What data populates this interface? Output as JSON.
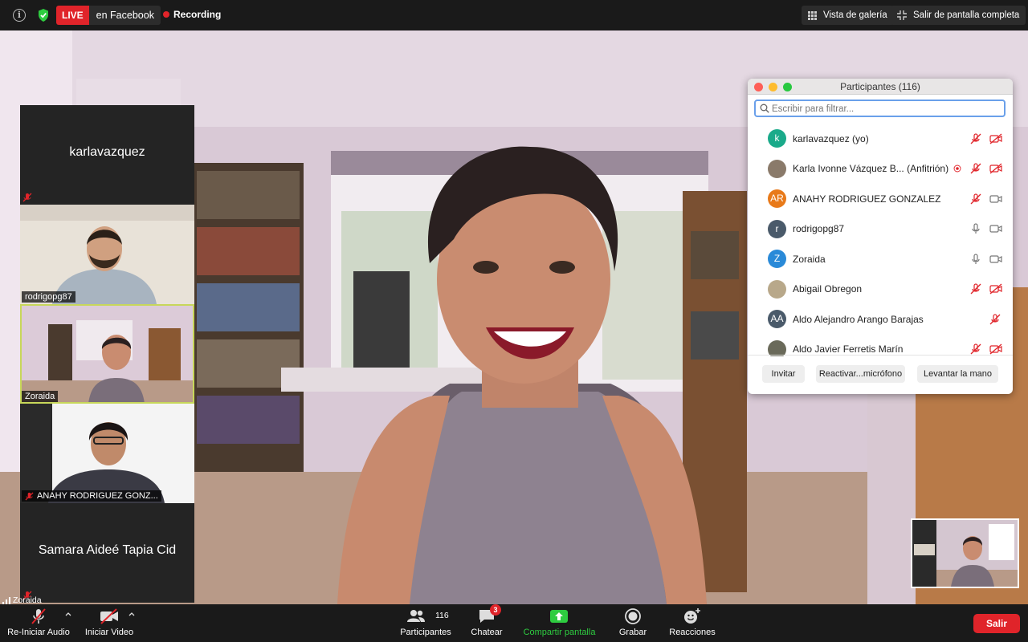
{
  "top_bar": {
    "live_badge": "LIVE",
    "live_destination": "en Facebook",
    "recording": "Recording",
    "gallery_view": "Vista de galería",
    "exit_fullscreen": "Salir de pantalla completa"
  },
  "thumbnails": [
    {
      "name": "karlavazquez",
      "video": false,
      "muted": true
    },
    {
      "name": "rodrigopg87",
      "video": true,
      "muted": false
    },
    {
      "name": "Zoraida",
      "video": true,
      "muted": false,
      "active": true
    },
    {
      "name": "ANAHY RODRIGUEZ GONZ...",
      "video": true,
      "muted": true
    },
    {
      "name": "Samara Aideé Tapia Cid",
      "video": false,
      "muted": true
    }
  ],
  "active_speaker": "Zoraida",
  "participants_panel": {
    "title": "Participantes (116)",
    "search_placeholder": "Escribir para filtrar...",
    "participants": [
      {
        "initial": "k",
        "name": "karlavazquez (yo)",
        "avatar_color": "#1aaa8a",
        "mic": "muted",
        "cam": "off"
      },
      {
        "initial": "",
        "name": "Karla Ivonne Vázquez B...  (Anfitrión)",
        "avatar_color": "#8a7a6a",
        "recording": true,
        "mic": "muted",
        "cam": "off"
      },
      {
        "initial": "AR",
        "name": "ANAHY RODRIGUEZ GONZALEZ",
        "avatar_color": "#e87a1a",
        "mic": "muted",
        "cam": "on"
      },
      {
        "initial": "r",
        "name": "rodrigopg87",
        "avatar_color": "#4a5a6a",
        "mic": "on",
        "cam": "on"
      },
      {
        "initial": "Z",
        "name": "Zoraida",
        "avatar_color": "#2a8ad8",
        "mic": "on",
        "cam": "on"
      },
      {
        "initial": "",
        "name": "Abigail Obregon",
        "avatar_color": "#b8a88a",
        "mic": "muted",
        "cam": "off"
      },
      {
        "initial": "AA",
        "name": "Aldo Alejandro Arango Barajas",
        "avatar_color": "#4a5a6a",
        "mic": "muted",
        "cam": "none"
      },
      {
        "initial": "",
        "name": "Aldo Javier Ferretis Marín",
        "avatar_color": "#6a6a5a",
        "mic": "muted",
        "cam": "off"
      }
    ],
    "buttons": {
      "invite": "Invitar",
      "unmute": "Reactivar...micrófono",
      "raise_hand": "Levantar la mano"
    }
  },
  "toolbar": {
    "audio": "Re-Iniciar Audio",
    "video": "Iniciar Video",
    "participants": "Participantes",
    "participants_count": "116",
    "chat": "Chatear",
    "chat_badge": "3",
    "share": "Compartir pantalla",
    "record": "Grabar",
    "reactions": "Reacciones",
    "leave": "Salir"
  },
  "colors": {
    "live_red": "#e0242a",
    "share_green": "#2ecc40",
    "active_border": "#c7d75a",
    "search_border": "#6aa0ea"
  }
}
